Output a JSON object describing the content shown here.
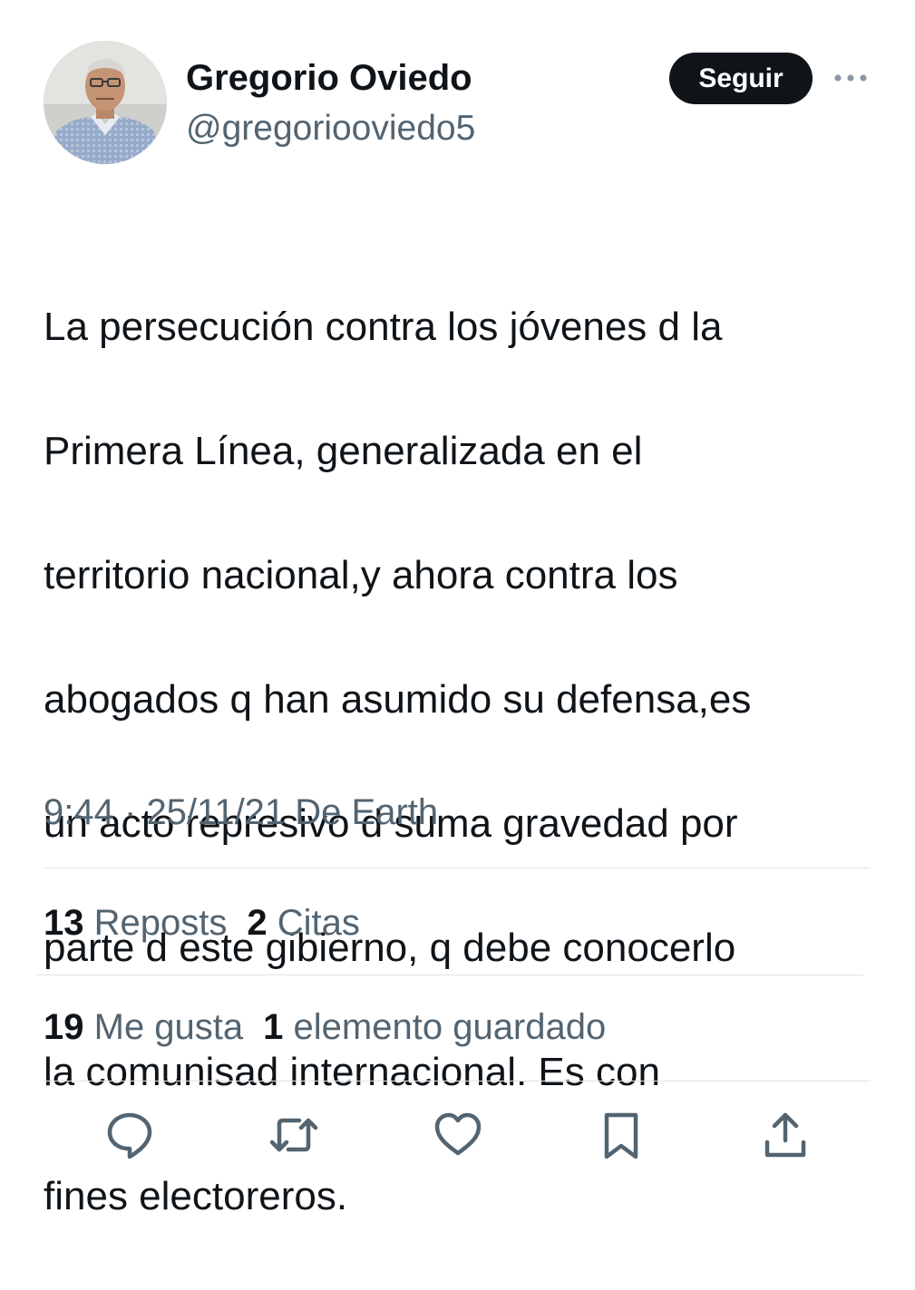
{
  "author": {
    "name": "Gregorio Oviedo",
    "handle": "@gregoriooviedo5",
    "avatar": "profile-photo"
  },
  "follow_button": {
    "label": "Seguir"
  },
  "more_icon": "more-horizontal-icon",
  "tweet": {
    "lines": [
      "La persecución contra los jóvenes d la",
      "Primera Línea, generalizada en el",
      "territorio nacional,y ahora contra los",
      "abogados q han asumido su defensa,es",
      "un acto represivo d suma gravedad por",
      "parte d este gibierno, q debe conocerlo",
      "la comunisad internacional. Es con",
      "fines electoreros."
    ]
  },
  "meta": {
    "time": "9:44",
    "separator": "·",
    "date": "25/11/21",
    "source": "De Earth"
  },
  "stats": {
    "reposts_count": "13",
    "reposts_label": "Reposts",
    "quotes_count": "2",
    "quotes_label": "Citas",
    "likes_count": "19",
    "likes_label": "Me gusta",
    "bookmarks_count": "1",
    "bookmarks_label": "elemento guardado"
  },
  "actions": [
    "reply-icon",
    "repost-icon",
    "like-icon",
    "bookmark-icon",
    "share-icon"
  ],
  "colors": {
    "text_primary": "#0f1419",
    "text_secondary": "#536471",
    "divider": "#dfe3e6",
    "button_bg": "#0f1419"
  }
}
